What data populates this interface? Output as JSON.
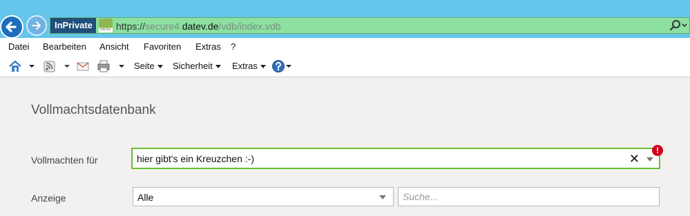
{
  "browser": {
    "inprivate_label": "InPrivate",
    "site_icon_text": "DATEV",
    "url": {
      "scheme": "https://",
      "host_prefix": "secure4.",
      "domain": "datev.de",
      "path": "/vdb/index.vdb"
    },
    "icons": {
      "back": "back-arrow-icon",
      "forward": "forward-arrow-icon",
      "search": "search-icon"
    }
  },
  "menubar": {
    "items": [
      "Datei",
      "Bearbeiten",
      "Ansicht",
      "Favoriten",
      "Extras",
      "?"
    ]
  },
  "commandbar": {
    "icons": [
      "home-icon",
      "rss-feed-icon",
      "read-mail-icon",
      "print-icon",
      "help-icon"
    ],
    "page_label": "Seite",
    "security_label": "Sicherheit",
    "tools_label": "Extras"
  },
  "main": {
    "title": "Vollmachtsdatenbank",
    "vollmacht": {
      "label": "Vollmachten für",
      "value": "hier gibt's ein Kreuzchen :-)",
      "clear_symbol": "✕",
      "error_symbol": "!"
    },
    "anzeige": {
      "label": "Anzeige",
      "selected": "Alle"
    },
    "search": {
      "placeholder": "Suche..."
    }
  },
  "colors": {
    "titlebar": "#65c5ea",
    "address_bg": "#8ce0a0",
    "inprivate_bg": "#1f4f7a",
    "valid_border": "#6cbf2c",
    "error": "#d0021b"
  }
}
